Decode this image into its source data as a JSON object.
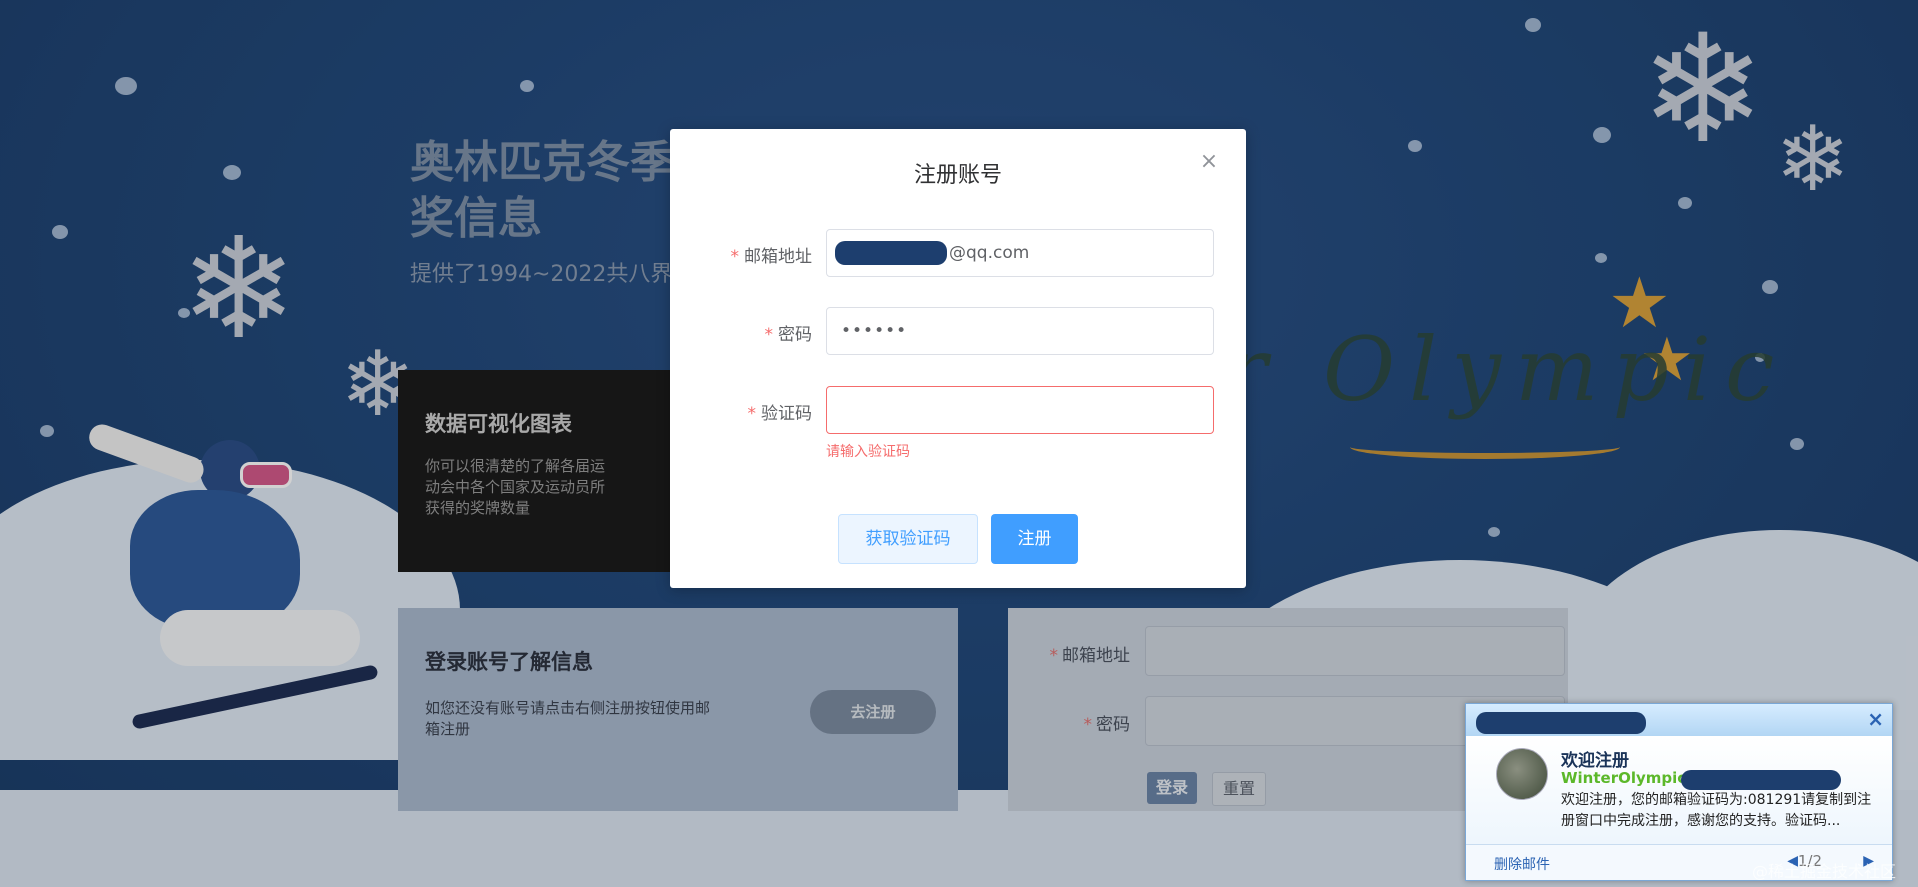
{
  "background": {
    "hero_title": "奥林匹克冬季奖信息",
    "hero_title_line1": "奥林匹克冬季",
    "hero_title_line2": "奖信息",
    "hero_subtitle": "提供了1994~2022共八界的",
    "olympic_text": "r Olympic"
  },
  "chart_card": {
    "title": "数据可视化图表",
    "description": "你可以很清楚的了解各届运动会中各个国家及运动员所获得的奖牌数量"
  },
  "login_info_card": {
    "title": "登录账号了解信息",
    "description": "如您还没有账号请点击右侧注册按钮使用邮箱注册",
    "go_register_label": "去注册"
  },
  "login_form": {
    "email_label": "邮箱地址",
    "password_label": "密码",
    "login_label": "登录",
    "reset_label": "重置"
  },
  "register_modal": {
    "title": "注册账号",
    "email_label": "邮箱地址",
    "email_value_suffix": "@qq.com",
    "password_label": "密码",
    "password_value": "••••••",
    "code_label": "验证码",
    "code_value": "",
    "code_error": "请输入验证码",
    "get_code_label": "获取验证码",
    "register_label": "注册",
    "required_mark": "*",
    "close_icon": "×"
  },
  "mail_notification": {
    "title": "欢迎注册",
    "sender": "WinterOlympic",
    "preview": "欢迎注册，您的邮箱验证码为:081291请复制到注册窗口中完成注册，感谢您的支持。验证码...",
    "delete_label": "删除邮件",
    "pager": "1/2",
    "close_icon": "×"
  },
  "watermark": "@稀土掘金技术社区",
  "colors": {
    "primary": "#409eff",
    "error": "#f56c6c",
    "background": "#1e3f6b"
  }
}
